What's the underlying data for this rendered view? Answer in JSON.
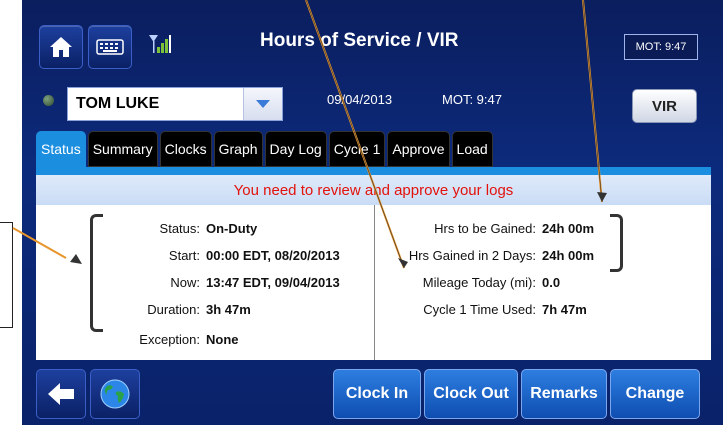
{
  "header": {
    "title": "Hours of Service / VIR",
    "mot_corner": "MOT: 9:47",
    "date": "09/04/2013",
    "mot": "MOT:  9:47",
    "vir_label": "VIR"
  },
  "driver": {
    "name": "TOM LUKE"
  },
  "tabs": [
    "Status",
    "Summary",
    "Clocks",
    "Graph",
    "Day Log",
    "Cycle 1",
    "Approve",
    "Load"
  ],
  "banner": "You need to review and approve your logs",
  "left_fields": [
    {
      "label": "Status:",
      "value": "On-Duty"
    },
    {
      "label": "Start:",
      "value": "00:00 EDT, 08/20/2013"
    },
    {
      "label": "Now:",
      "value": "13:47 EDT, 09/04/2013"
    },
    {
      "label": "Duration:",
      "value": "3h 47m"
    },
    {
      "label": "Exception:",
      "value": "None"
    }
  ],
  "right_fields": [
    {
      "label": "Hrs to be Gained:",
      "value": "24h 00m"
    },
    {
      "label": "Hrs Gained in 2 Days:",
      "value": "24h 00m"
    },
    {
      "label": "Mileage Today (mi):",
      "value": "0.0"
    },
    {
      "label": "Cycle 1 Time Used:",
      "value": "7h 47m"
    }
  ],
  "footer": {
    "clock_in": "Clock In",
    "clock_out": "Clock Out",
    "remarks": "Remarks",
    "change": "Change"
  },
  "colors": {
    "accent": "#1c8ee0",
    "alert": "#e3120b",
    "annotation": "#e8942a"
  }
}
